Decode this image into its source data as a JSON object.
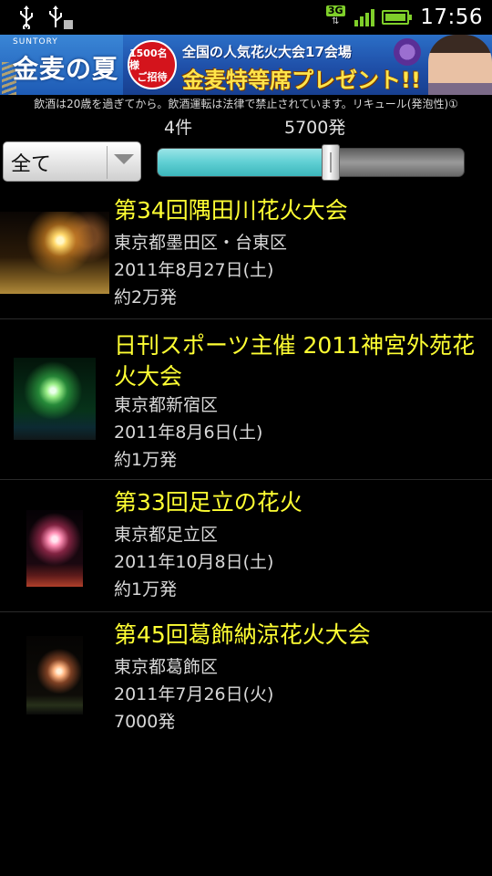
{
  "status_bar": {
    "network": "3G",
    "time": "17:56",
    "icons": [
      "usb-icon",
      "usb-debug-icon",
      "network-3g-icon",
      "signal-icon",
      "battery-icon"
    ]
  },
  "ad": {
    "brand": "SUNTORY",
    "title": "金麦の夏",
    "badge_line1": "1500名様",
    "badge_line2": "ご招待",
    "line1": "全国の人気花火大会17会場",
    "line2": "金麦特等席プレゼント!!"
  },
  "notice": "飲酒は20歳を過ぎてから。飲酒運転は法律で禁止されています。リキュール(発泡性)①",
  "filter": {
    "count_label": "4件",
    "shots_label": "5700発",
    "spinner_value": "全て",
    "slider_fraction": 0.56
  },
  "events": [
    {
      "title": "第34回隅田川花火大会",
      "location": "東京都墨田区・台東区",
      "date": "2011年8月27日(土)",
      "shots": "約2万発"
    },
    {
      "title": "日刊スポーツ主催 2011神宮外苑花火大会",
      "location": "東京都新宿区",
      "date": "2011年8月6日(土)",
      "shots": "約1万発"
    },
    {
      "title": "第33回足立の花火",
      "location": "東京都足立区",
      "date": "2011年10月8日(土)",
      "shots": "約1万発"
    },
    {
      "title": "第45回葛飾納涼花火大会",
      "location": "東京都葛飾区",
      "date": "2011年7月26日(火)",
      "shots": "7000発"
    }
  ]
}
